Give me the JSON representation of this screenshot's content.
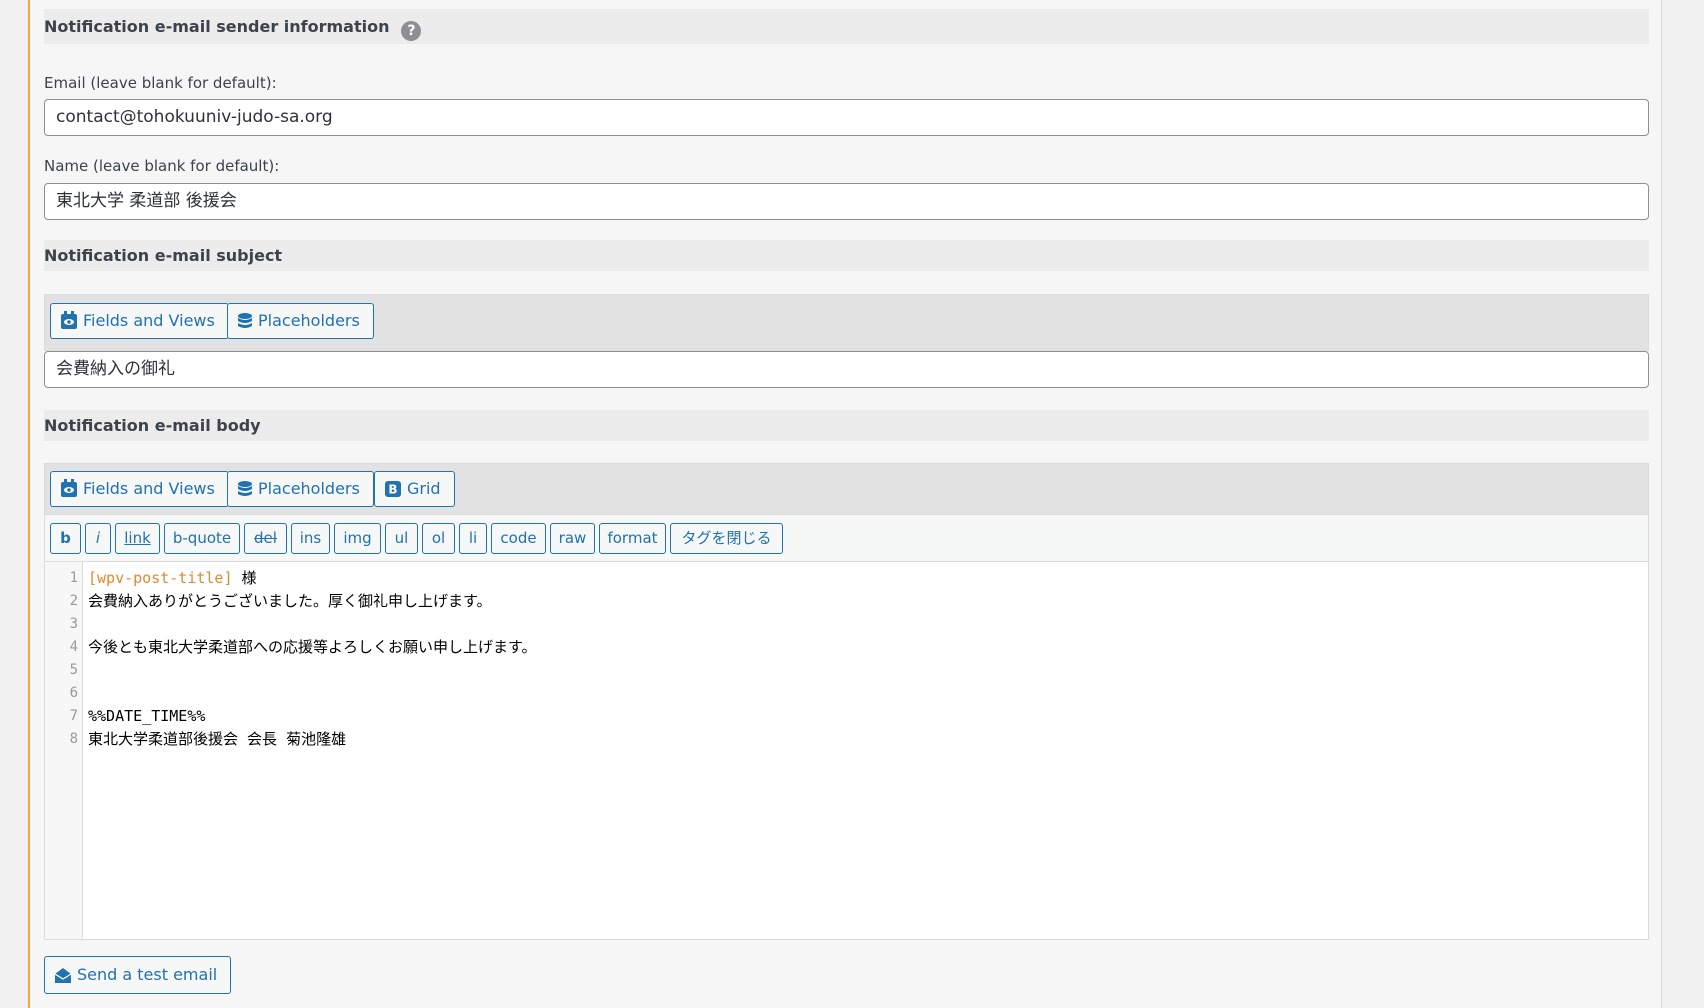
{
  "sender": {
    "heading": "Notification e-mail sender information",
    "help_icon": "?",
    "email_label": "Email (leave blank for default):",
    "email_value": "contact@tohokuuniv-judo-sa.org",
    "name_label": "Name (leave blank for default):",
    "name_value": "東北大学 柔道部 後援会"
  },
  "subject": {
    "heading": "Notification e-mail subject",
    "fields_button": "Fields and Views",
    "placeholders_button": "Placeholders",
    "value": "会費納入の御礼"
  },
  "body": {
    "heading": "Notification e-mail body",
    "fields_button": "Fields and Views",
    "placeholders_button": "Placeholders",
    "grid_button": "Grid",
    "quicktags": [
      "b",
      "i",
      "link",
      "b-quote",
      "del",
      "ins",
      "img",
      "ul",
      "ol",
      "li",
      "code",
      "raw",
      "format",
      "タグを閉じる"
    ],
    "line_numbers": [
      "1",
      "2",
      "3",
      "4",
      "5",
      "6",
      "7",
      "8"
    ],
    "line1_shortcode": "[wpv-post-title]",
    "line1_rest": " 様",
    "line2": "会費納入ありがとうございました。厚く御礼申し上げます。",
    "line4": "今後とも東北大学柔道部への応援等よろしくお願い申し上げます。",
    "line7": "%%DATE_TIME%%",
    "line8": "東北大学柔道部後援会 会長 菊池隆雄"
  },
  "send_test_button": "Send a test email",
  "colors": {
    "accent": "#2271b1",
    "left_border": "#f0a742",
    "shortcode": "#e08a2c"
  }
}
